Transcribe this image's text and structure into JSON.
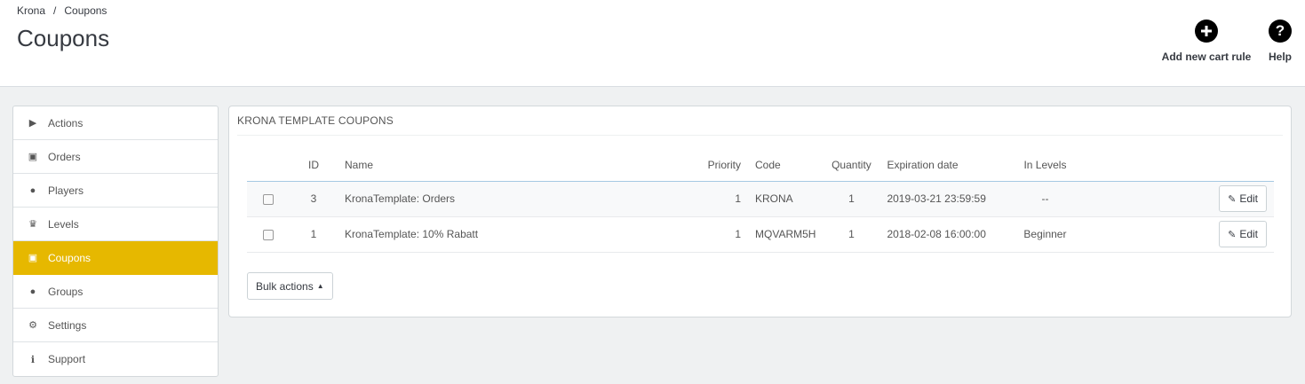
{
  "breadcrumb": {
    "root": "Krona",
    "separator": "/",
    "current": "Coupons"
  },
  "page_title": "Coupons",
  "toolbar": {
    "add_label": "Add new cart rule",
    "add_icon": "plus-circle-icon",
    "help_label": "Help",
    "help_icon": "question-circle-icon"
  },
  "sidebar": {
    "active_color": "#e6b800",
    "items": [
      {
        "label": "Actions",
        "icon": "play-circle-icon",
        "glyph": "▶"
      },
      {
        "label": "Orders",
        "icon": "money-icon",
        "glyph": "▣"
      },
      {
        "label": "Players",
        "icon": "user-icon",
        "glyph": "●"
      },
      {
        "label": "Levels",
        "icon": "trophy-icon",
        "glyph": "♛"
      },
      {
        "label": "Coupons",
        "icon": "money-icon",
        "glyph": "▣",
        "active": true
      },
      {
        "label": "Groups",
        "icon": "users-icon",
        "glyph": "●"
      },
      {
        "label": "Settings",
        "icon": "cogs-icon",
        "glyph": "⚙"
      },
      {
        "label": "Support",
        "icon": "info-circle-icon",
        "glyph": "ℹ"
      }
    ]
  },
  "panel": {
    "title": "KRONA TEMPLATE COUPONS",
    "columns": [
      "ID",
      "Name",
      "Priority",
      "Code",
      "Quantity",
      "Expiration date",
      "In Levels"
    ],
    "rows": [
      {
        "id": "3",
        "name": "KronaTemplate: Orders",
        "priority": "1",
        "code": "KRONA",
        "quantity": "1",
        "expiration": "2019-03-21 23:59:59",
        "levels": "--",
        "action": "Edit"
      },
      {
        "id": "1",
        "name": "KronaTemplate: 10% Rabatt",
        "priority": "1",
        "code": "MQVARM5H",
        "quantity": "1",
        "expiration": "2018-02-08 16:00:00",
        "levels": "Beginner",
        "action": "Edit"
      }
    ],
    "bulk_label": "Bulk actions"
  }
}
